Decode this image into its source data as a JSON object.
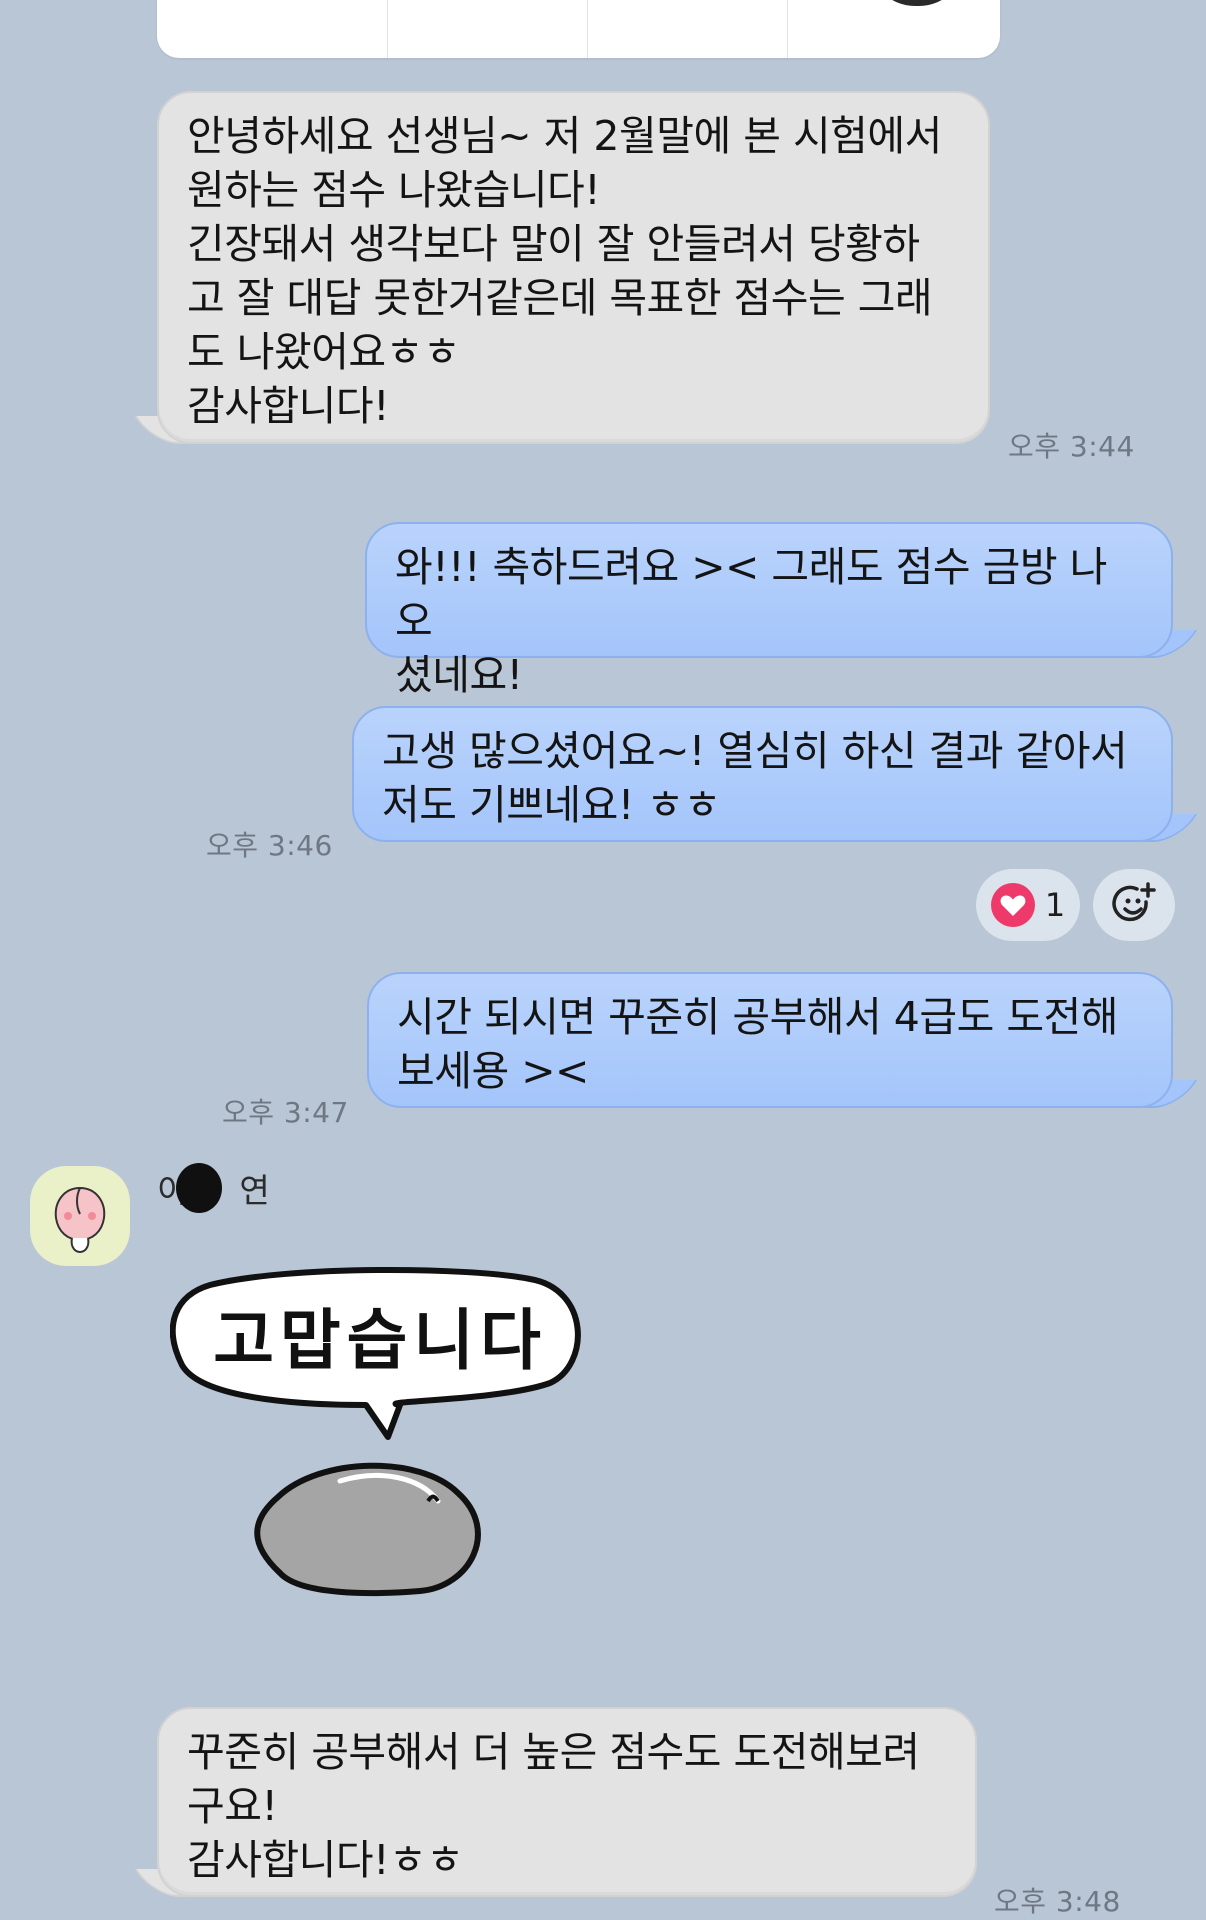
{
  "messages": [
    {
      "direction": "incoming",
      "text": "안녕하세요 선생님~ 저 2월말에 본 시험에서\n원하는 점수 나왔습니다!\n긴장돼서 생각보다 말이 잘 안들려서 당황하\n고 잘 대답 못한거같은데 목표한 점수는 그래\n도 나왔어요ㅎㅎ\n감사합니다!",
      "time": "오후 3:44"
    },
    {
      "direction": "outgoing",
      "text": "와!!! 축하드려요 >< 그래도 점수 금방 나오\n셨네요!"
    },
    {
      "direction": "outgoing",
      "text": "고생 많으셨어요~! 열심히 하신 결과 같아서\n저도 기쁘네요! ㅎㅎ",
      "time": "오후 3:46"
    },
    {
      "direction": "outgoing",
      "text": "시간 되시면 꾸준히 공부해서 4급도 도전해\n보세용 ><",
      "time": "오후 3:47"
    },
    {
      "direction": "incoming",
      "text": "꾸준히 공부해서 더 높은 점수도 도전해보려\n구요!\n감사합니다!ㅎㅎ",
      "time": "오후 3:48"
    }
  ],
  "reaction": {
    "icon": "heart-icon",
    "count": "1",
    "color": "#ee3a6a"
  },
  "add_reaction_icon": "smile-plus-icon",
  "sender": {
    "name_start": "이",
    "name_end": "연",
    "avatar_icon": "peach-character-icon"
  },
  "sticker": {
    "text": "고맙습니다",
    "icon": "thank-you-sticker"
  },
  "colors": {
    "background": "#b9c6d6",
    "incoming_bubble": "#e3e3e3",
    "outgoing_bubble": "#a4c5fb"
  }
}
